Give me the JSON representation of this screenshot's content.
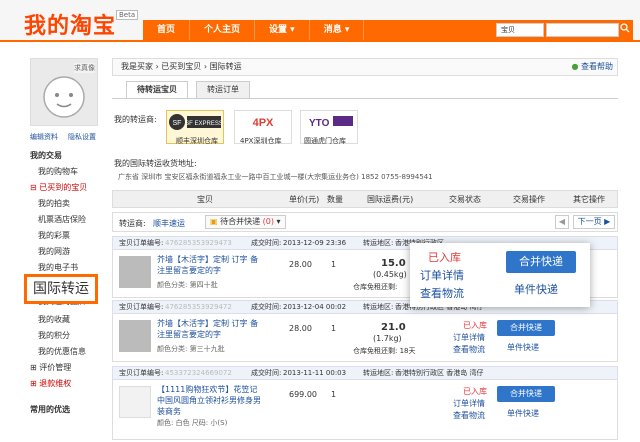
{
  "header": {
    "logo": "我的淘宝",
    "beta": "Beta",
    "nav": [
      "首页",
      "个人主页",
      "设置 ▾",
      "消息 ▾"
    ],
    "search_type": "宝贝",
    "search_icon": "search-icon"
  },
  "sidebar": {
    "avatar_label": "求真像",
    "links": [
      "编辑资料",
      "隐私设置"
    ],
    "section1": "我的交易",
    "items": [
      "我的购物车",
      "已买到的宝贝",
      "我的拍卖",
      "机票酒店保险",
      "我的彩票",
      "我的网游",
      "我的电子书"
    ],
    "highlight": "国际转运",
    "items2": [
      "我关注的品牌",
      "我的收藏",
      "我的积分",
      "我的优惠信息",
      "评价管理",
      "退款维权"
    ],
    "section2": "常用的优选"
  },
  "breadcrumb": {
    "path": "我是买家 › 已买到宝贝 › 国际转运",
    "help": "查看帮助"
  },
  "tabs": [
    "待转运宝贝",
    "转运订单"
  ],
  "carriers_label": "我的转运商:",
  "carriers": [
    {
      "name": "SF EXPRESS",
      "cap": "顺丰深圳仓库"
    },
    {
      "name": "4PX",
      "cap": "4PX深圳仓库"
    },
    {
      "name": "YTO",
      "cap": "圆通虎门仓库"
    }
  ],
  "address_label": "我的国际转运收货地址:",
  "address": "广东省 深圳市 宝安区福永街道福永工业一路中百工业城一楼(大宗集运业务仓) 1852     0755-8994541",
  "table_head": [
    "宝贝",
    "单价(元)",
    "数量",
    "国际运费(元)",
    "交易状态",
    "交易操作",
    "其它操作"
  ],
  "filter": {
    "label": "转运商:",
    "carrier": "顺丰速运",
    "pending": "待合并快递",
    "count": "(0)",
    "prev": "◀",
    "next": "下一页 ▶"
  },
  "orders": [
    {
      "order_label": "宝贝订单编号:",
      "order_no": "476285353929473",
      "time_label": "成交时间:",
      "time": "2013-12-09 23:36",
      "region_label": "转运地区:",
      "region": "香港特别行政区",
      "title": "芥墙【木活字】定制 订字 备注里留言要定的字",
      "sku": "颜色分类: 第四十批",
      "price": "28.00",
      "qty": "1",
      "fee": "15.0",
      "weight": "(0.45kg)",
      "store": "仓库免租还剩:",
      "days": "",
      "status": "已入库",
      "detail": "订单详情",
      "logistics": "查看物流",
      "merge": "合并快递",
      "single": "单件快递"
    },
    {
      "order_label": "宝贝订单编号:",
      "order_no": "476285353929472",
      "time_label": "成交时间:",
      "time": "2013-12-04 00:02",
      "region_label": "转运地区:",
      "region": "香港特别行政区 香港岛 湾仔",
      "title": "芥墙【木活字】定制 订字 备注里留言要定的字",
      "sku": "颜色分类: 第三十九批",
      "price": "28.00",
      "qty": "1",
      "fee": "21.0",
      "weight": "(1.7kg)",
      "store": "仓库免租还剩:",
      "days": "18天",
      "status": "已入库",
      "detail": "订单详情",
      "logistics": "查看物流",
      "merge": "合并快递",
      "single": "单件快递"
    },
    {
      "order_label": "宝贝订单编号:",
      "order_no": "453372324669072",
      "time_label": "成交时间:",
      "time": "2013-11-11 00:03",
      "region_label": "转运地区:",
      "region": "香港特别行政区 香港岛 湾仔",
      "title": "【1111购物狂欢节】花笠记中国风圆角立领衬衫男修身男装商务",
      "sku": "颜色: 白色 尺码: 小(S)",
      "price": "699.00",
      "qty": "1",
      "fee": "",
      "weight": "",
      "store": "",
      "days": "",
      "status": "已入库",
      "detail": "订单详情",
      "logistics": "查看物流",
      "merge": "合并快递",
      "single": "单件快递"
    }
  ],
  "popup": {
    "status": "已入库",
    "detail": "订单详情",
    "logistics": "查看物流",
    "merge": "合并快递",
    "single": "单件快递"
  },
  "colors": {
    "brand": "#ff6a00",
    "link": "#1c4f9e",
    "button": "#2f75c9",
    "status": "#e4393c"
  }
}
